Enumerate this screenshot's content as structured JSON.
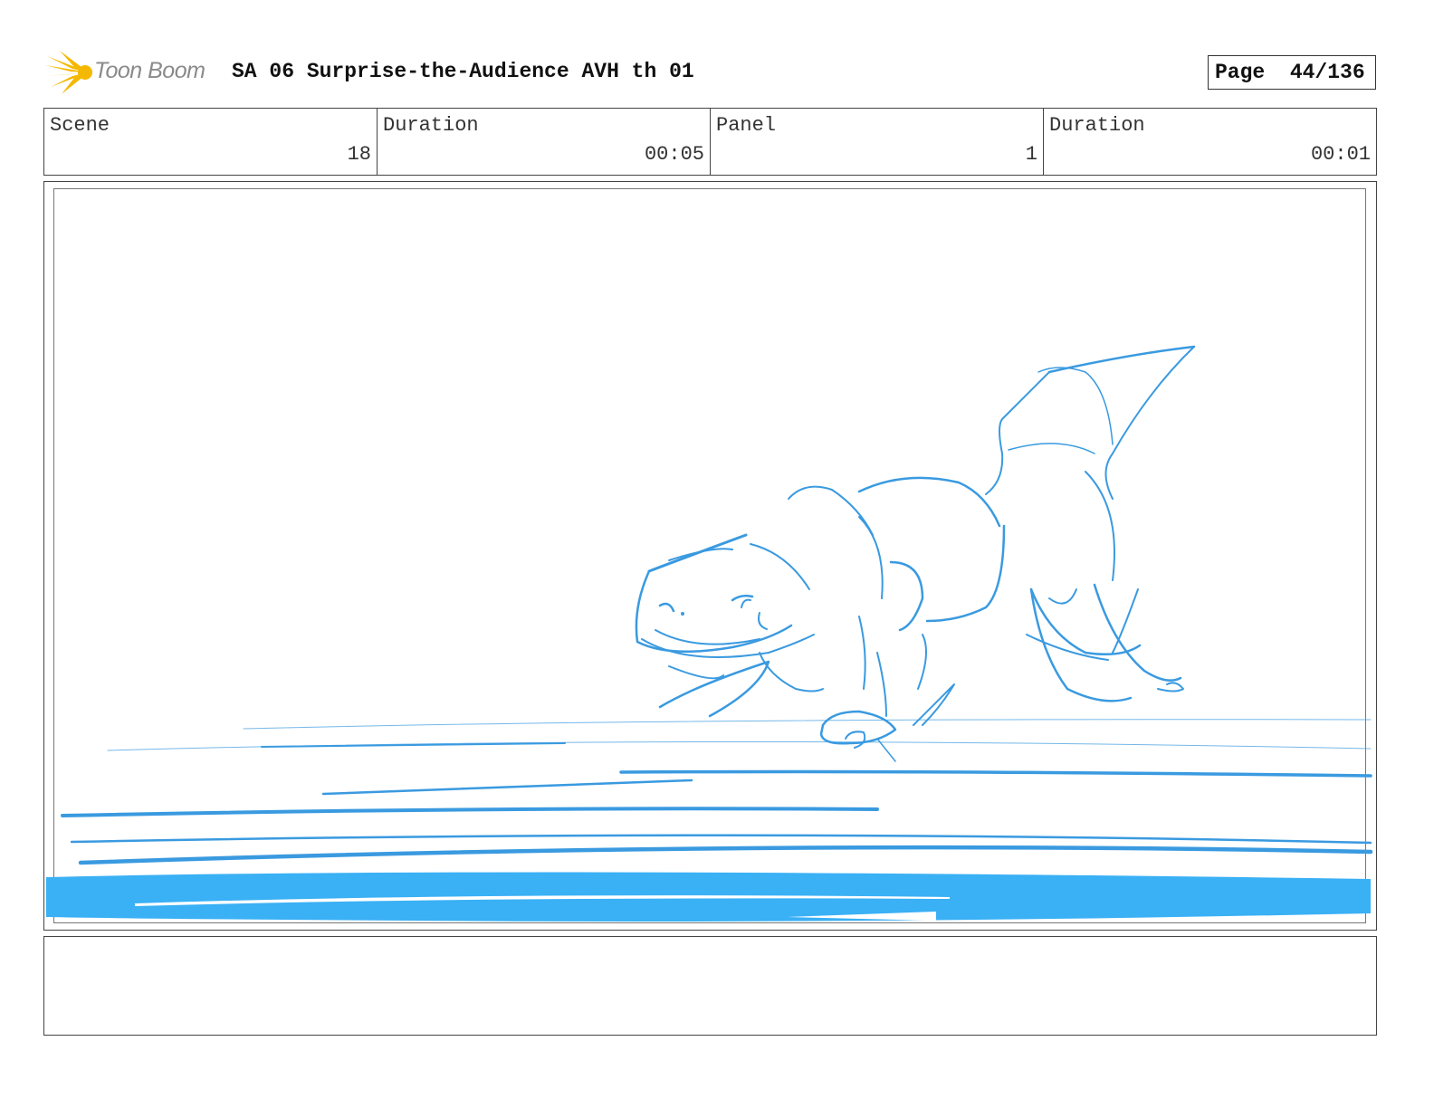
{
  "header": {
    "logo_text": "Toon Boom",
    "title": "SA 06 Surprise-the-Audience AVH th 01",
    "page_label": "Page  44/136"
  },
  "info": {
    "scene_label": "Scene",
    "scene_value": "18",
    "duration_label": "Duration",
    "duration_value": "00:05",
    "panel_label": "Panel",
    "panel_value": "1",
    "panel_duration_label": "Duration",
    "panel_duration_value": "00:01"
  },
  "colors": {
    "sketch": "#3a9ae0",
    "logo": "#f5b800"
  },
  "notes": ""
}
